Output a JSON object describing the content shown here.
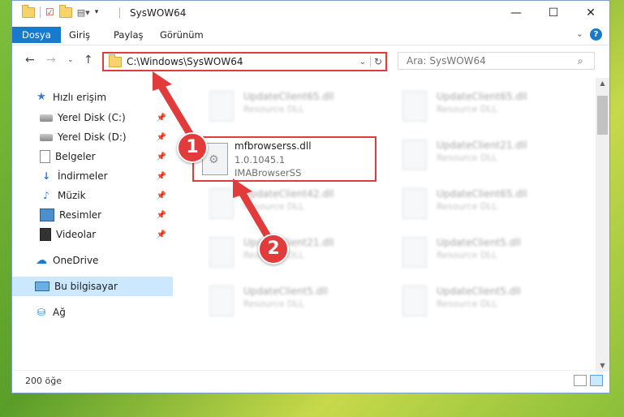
{
  "title_bar": {
    "title": "SysWOW64",
    "minimize": "—",
    "maximize": "☐",
    "close": "✕"
  },
  "ribbon": {
    "tabs": [
      "Dosya",
      "Giriş",
      "Paylaş",
      "Görünüm"
    ],
    "help": "?"
  },
  "address_bar": {
    "path": "C:\\Windows\\SysWOW64"
  },
  "search": {
    "placeholder": "Ara: SysWOW64"
  },
  "nav_pane": {
    "items": [
      {
        "label": "Hızlı erişim",
        "icon": "star-icon"
      },
      {
        "label": "Yerel Disk (C:)",
        "icon": "drive-icon",
        "pinned": true
      },
      {
        "label": "Yerel Disk (D:)",
        "icon": "drive-icon",
        "pinned": true
      },
      {
        "label": "Belgeler",
        "icon": "documents-icon",
        "pinned": true
      },
      {
        "label": "İndirmeler",
        "icon": "downloads-icon",
        "pinned": true
      },
      {
        "label": "Müzik",
        "icon": "music-icon",
        "pinned": true
      },
      {
        "label": "Resimler",
        "icon": "pictures-icon",
        "pinned": true
      },
      {
        "label": "Videolar",
        "icon": "videos-icon",
        "pinned": true
      },
      {
        "label": "OneDrive",
        "icon": "onedrive-icon"
      },
      {
        "label": "Bu bilgisayar",
        "icon": "this-pc-icon",
        "selected": true
      },
      {
        "label": "Ağ",
        "icon": "network-icon"
      }
    ]
  },
  "files": {
    "highlighted": {
      "name": "mfbrowserss.dll",
      "version": "1.0.1045.1",
      "description": "IMABrowserSS"
    },
    "blurred": [
      {
        "name": "UpdateClient65.dll",
        "desc": "Resource DLL"
      },
      {
        "name": "UpdateClient65.dll",
        "desc": "Resource DLL"
      },
      {
        "name": "UpdateClient21.dll",
        "desc": "Resource DLL"
      },
      {
        "name": "UpdateClient42.dll",
        "desc": "Resource DLL"
      },
      {
        "name": "UpdateClient65.dll",
        "desc": "Resource DLL"
      },
      {
        "name": "UpdateClient21.dll",
        "desc": "Resource DLL"
      },
      {
        "name": "UpdateClient5.dll",
        "desc": "Resource DLL"
      },
      {
        "name": "UpdateClient5.dll",
        "desc": "Resource DLL"
      },
      {
        "name": "UpdateClient5.dll",
        "desc": "Resource DLL"
      }
    ]
  },
  "status_bar": {
    "count": "200 öğe"
  },
  "annotations": {
    "marker1": "1",
    "marker2": "2",
    "color": "#e23b3b"
  }
}
